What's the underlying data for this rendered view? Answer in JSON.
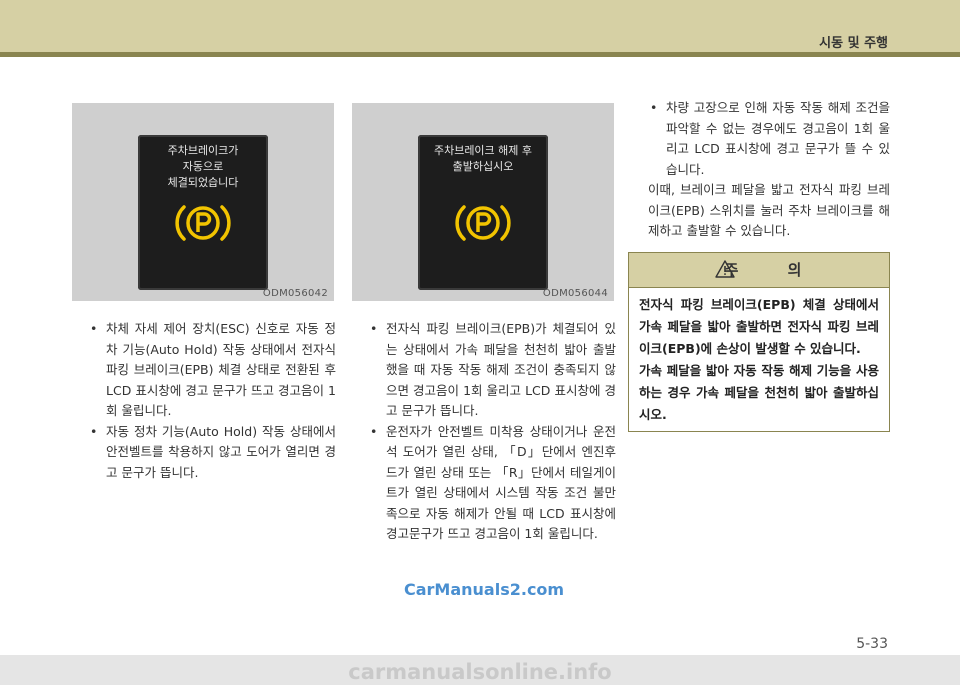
{
  "header": {
    "section_title": "시동 및 주행"
  },
  "figures": [
    {
      "screen_text": "주차브레이크가\n자동으로\n체결되었습니다",
      "code": "ODM056042",
      "icon": "epb-warning-icon"
    },
    {
      "screen_text": "주차브레이크 해제 후\n출발하십시오",
      "code": "ODM056044",
      "icon": "epb-warning-icon"
    }
  ],
  "colors": {
    "epb_icon": "#f2c400",
    "header_band": "#d6d0a4",
    "header_line": "#8a8550"
  },
  "column1": {
    "bullets": [
      "차체 자세 제어 장치(ESC) 신호로 자동 정차 기능(Auto Hold) 작동 상태에서 전자식 파킹 브레이크(EPB) 체결 상태로 전환된 후 LCD 표시창에 경고 문구가 뜨고 경고음이 1회 울립니다.",
      "자동 정차 기능(Auto Hold) 작동 상태에서 안전벨트를 착용하지 않고 도어가 열리면 경고 문구가 뜹니다."
    ]
  },
  "column2": {
    "bullets": [
      "전자식 파킹 브레이크(EPB)가 체결되어 있는 상태에서 가속 페달을 천천히 밟아 출발했을 때 자동 작동 해제 조건이 충족되지 않으면 경고음이 1회 울리고 LCD 표시창에 경고 문구가 뜹니다.",
      "운전자가 안전벨트 미착용 상태이거나 운전석 도어가 열린 상태, 「D」단에서 엔진후드가 열린 상태 또는 「R」단에서 테일게이트가 열린 상태에서 시스템 작동 조건 불만족으로 자동 해제가 안될 때 LCD 표시창에 경고문구가 뜨고 경고음이 1회 울립니다."
    ]
  },
  "column3": {
    "bullets": [
      "차량 고장으로 인해 자동 작동 해제 조건을 파악할 수 없는 경우에도 경고음이 1회 울리고 LCD 표시창에 경고 문구가 뜰 수 있습니다."
    ],
    "paragraph": "이때, 브레이크 페달을 밟고 전자식 파킹 브레이크(EPB) 스위치를 눌러 주차 브레이크를 해제하고 출발할 수 있습니다."
  },
  "caution": {
    "title": "주 의",
    "paragraphs": [
      "전자식 파킹 브레이크(EPB) 체결 상태에서 가속 페달을 밟아 출발하면 전자식 파킹 브레이크(EPB)에 손상이 발생할 수 있습니다.",
      "가속 페달을 밟아 자동 작동 해제 기능을 사용하는 경우 가속 페달을 천천히 밟아 출발하십시오."
    ]
  },
  "watermark": "CarManuals2.com",
  "page_number": "5-33",
  "footer": "carmanualsonline.info"
}
